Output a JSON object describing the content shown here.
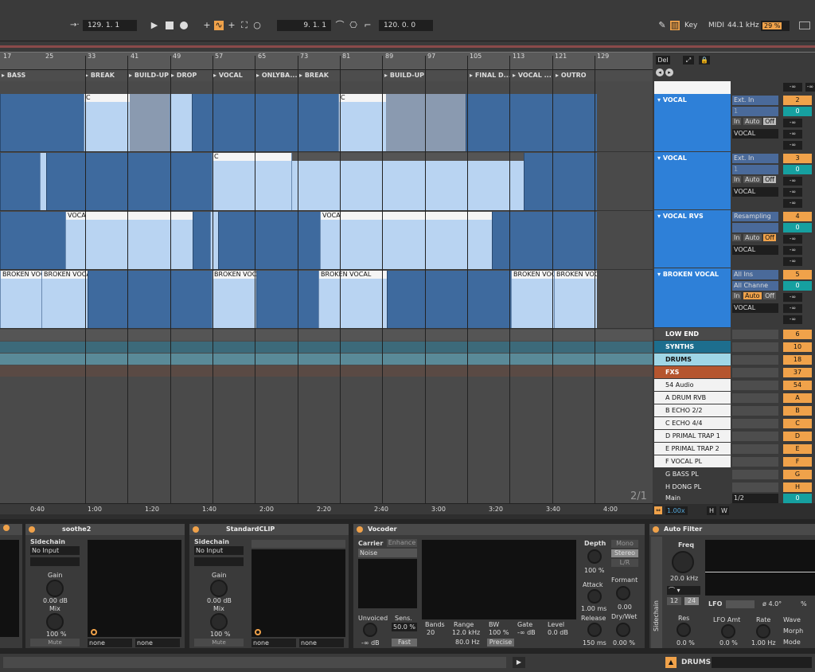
{
  "transport": {
    "position": "129. 1. 1",
    "loop_start": "9. 1. 1",
    "loop_length": "120. 0. 0",
    "key_label": "Key",
    "midi_label": "MIDI",
    "sample_rate": "44.1 kHz",
    "cpu": "29 %"
  },
  "ruler": {
    "bars": [
      "17",
      "25",
      "33",
      "41",
      "49",
      "57",
      "65",
      "73",
      "81",
      "89",
      "97",
      "105",
      "113",
      "121",
      "129"
    ]
  },
  "sections": [
    "BASS",
    "BREAK",
    "BUILD-UP",
    "DROP",
    "VOCAL",
    "ONLYBA...",
    "BREAK",
    "BUILD-UP",
    "FINAL D...",
    "VOCAL ...",
    "OUTRO"
  ],
  "clip_titles": {
    "vocal_c": "C",
    "vocal_rvs": "VOCA",
    "broken": "BROKEN VOCAL",
    "broken_short": "BROKEN VOC"
  },
  "session_controls": {
    "del": "Del"
  },
  "tracks": [
    {
      "name": "VOCAL",
      "input": "Ext. In",
      "channel": "1",
      "monitor": [
        "In",
        "Auto",
        "Off"
      ],
      "output": "VOCAL",
      "number": "2",
      "send": "0"
    },
    {
      "name": "VOCAL",
      "input": "Ext. In",
      "channel": "1",
      "monitor": [
        "In",
        "Auto",
        "Off"
      ],
      "output": "VOCAL",
      "number": "3",
      "send": "0"
    },
    {
      "name": "VOCAL RVS",
      "input": "Resampling",
      "channel": "",
      "monitor": [
        "In",
        "Auto",
        "Off"
      ],
      "output": "VOCAL",
      "number": "4",
      "send": "0"
    },
    {
      "name": "BROKEN VOCAL",
      "input": "All Ins",
      "channel": "All Channe",
      "monitor": [
        "In",
        "Auto",
        "Off"
      ],
      "output": "VOCAL",
      "number": "5",
      "send": "0"
    }
  ],
  "group_tracks": [
    {
      "name": "LOW END",
      "number": "6",
      "color": "#4a4a4a"
    },
    {
      "name": "SYNTHS",
      "number": "10",
      "color": "#1d6e8e"
    },
    {
      "name": "DRUMS",
      "number": "18",
      "color": "#9fd6e6"
    },
    {
      "name": "FXS",
      "number": "37",
      "color": "#b5552e"
    }
  ],
  "return_tracks": [
    {
      "name": "54 Audio",
      "number": "54"
    },
    {
      "name": "A DRUM RVB",
      "number": "A"
    },
    {
      "name": "B ECHO 2/2",
      "number": "B"
    },
    {
      "name": "C ECHO 4/4",
      "number": "C"
    },
    {
      "name": "D PRIMAL TRAP 1",
      "number": "D"
    },
    {
      "name": "E PRIMAL TRAP 2",
      "number": "E"
    },
    {
      "name": "F VOCAL PL",
      "number": "F"
    },
    {
      "name": "G BASS PL",
      "number": "G"
    },
    {
      "name": "H DONG PL",
      "number": "H"
    }
  ],
  "main": {
    "name": "Main",
    "output": "1/2",
    "number": "0"
  },
  "vol_inf": "-∞",
  "vol_values": [
    "-∞",
    "-∞",
    "-∞",
    "-∞",
    "-∞",
    "-∞",
    "-∞",
    "-∞",
    "-∞",
    "-∞",
    "-∞",
    "-∞",
    "-∞",
    "-∞",
    "-∞",
    "-∞",
    "-∞",
    "-∞",
    "-∞",
    "-∞",
    "-∞",
    "-∞",
    "-∞",
    "-∞",
    "-∞",
    "-∞",
    "-∞",
    "-∞",
    "-∞"
  ],
  "page_indicator": "2/1",
  "zoom": "1.00x",
  "hw": [
    "H",
    "W"
  ],
  "timeline": [
    "0:40",
    "1:00",
    "1:20",
    "1:40",
    "2:00",
    "2:20",
    "2:40",
    "3:00",
    "3:20",
    "3:40",
    "4:00"
  ],
  "devices": {
    "soothe2": {
      "title": "soothe2",
      "sidechain": "Sidechain",
      "input": "No Input",
      "gain_label": "Gain",
      "gain": "0.00 dB",
      "mix_label": "Mix",
      "mix": "100 %",
      "mute": "Mute",
      "none1": "none",
      "none2": "none"
    },
    "standardclip": {
      "title": "StandardCLIP",
      "sidechain": "Sidechain",
      "input": "No Input",
      "gain_label": "Gain",
      "gain": "0.00 dB",
      "mix_label": "Mix",
      "mix": "100 %",
      "mute": "Mute",
      "none1": "none",
      "none2": "none"
    },
    "vocoder": {
      "title": "Vocoder",
      "carrier": "Carrier",
      "enhance": "Enhance",
      "carrier_type": "Noise",
      "unvoiced_label": "Unvoiced",
      "unvoiced": "-∞ dB",
      "sens_label": "Sens.",
      "sens": "50.0 %",
      "fast": "Fast",
      "bands_label": "Bands",
      "bands": "20",
      "range_label": "Range",
      "range_hi": "12.0 kHz",
      "range_lo": "80.0 Hz",
      "bw_label": "BW",
      "bw": "100 %",
      "precise": "Precise",
      "gate_label": "Gate",
      "gate": "-∞ dB",
      "level_label": "Level",
      "level": "0.0 dB",
      "depth_label": "Depth",
      "depth": "100 %",
      "attack_label": "Attack",
      "attack": "1.00 ms",
      "release_label": "Release",
      "release": "150 ms",
      "mono": "Mono",
      "stereo": "Stereo",
      "lr": "L/R",
      "formant_label": "Formant",
      "formant": "0.00",
      "drywet_label": "Dry/Wet",
      "drywet": "0.00 %"
    },
    "autofilter": {
      "title": "Auto Filter",
      "freq_label": "Freq",
      "freq": "20.0 kHz",
      "slope_a": "12",
      "slope_b": "24",
      "res_label": "Res",
      "res": "0.0 %",
      "lfo_label": "LFO",
      "phase": "ø 4.0°",
      "lfo_amt_label": "LFO Amt",
      "lfo_amt": "0.0 %",
      "rate_label": "Rate",
      "rate": "1.00 Hz",
      "wave_label": "Wave",
      "morph_label": "Morph",
      "mode_label": "Mode",
      "sidechain": "Sidechain"
    }
  },
  "status": {
    "selected_track": "DRUMS"
  }
}
